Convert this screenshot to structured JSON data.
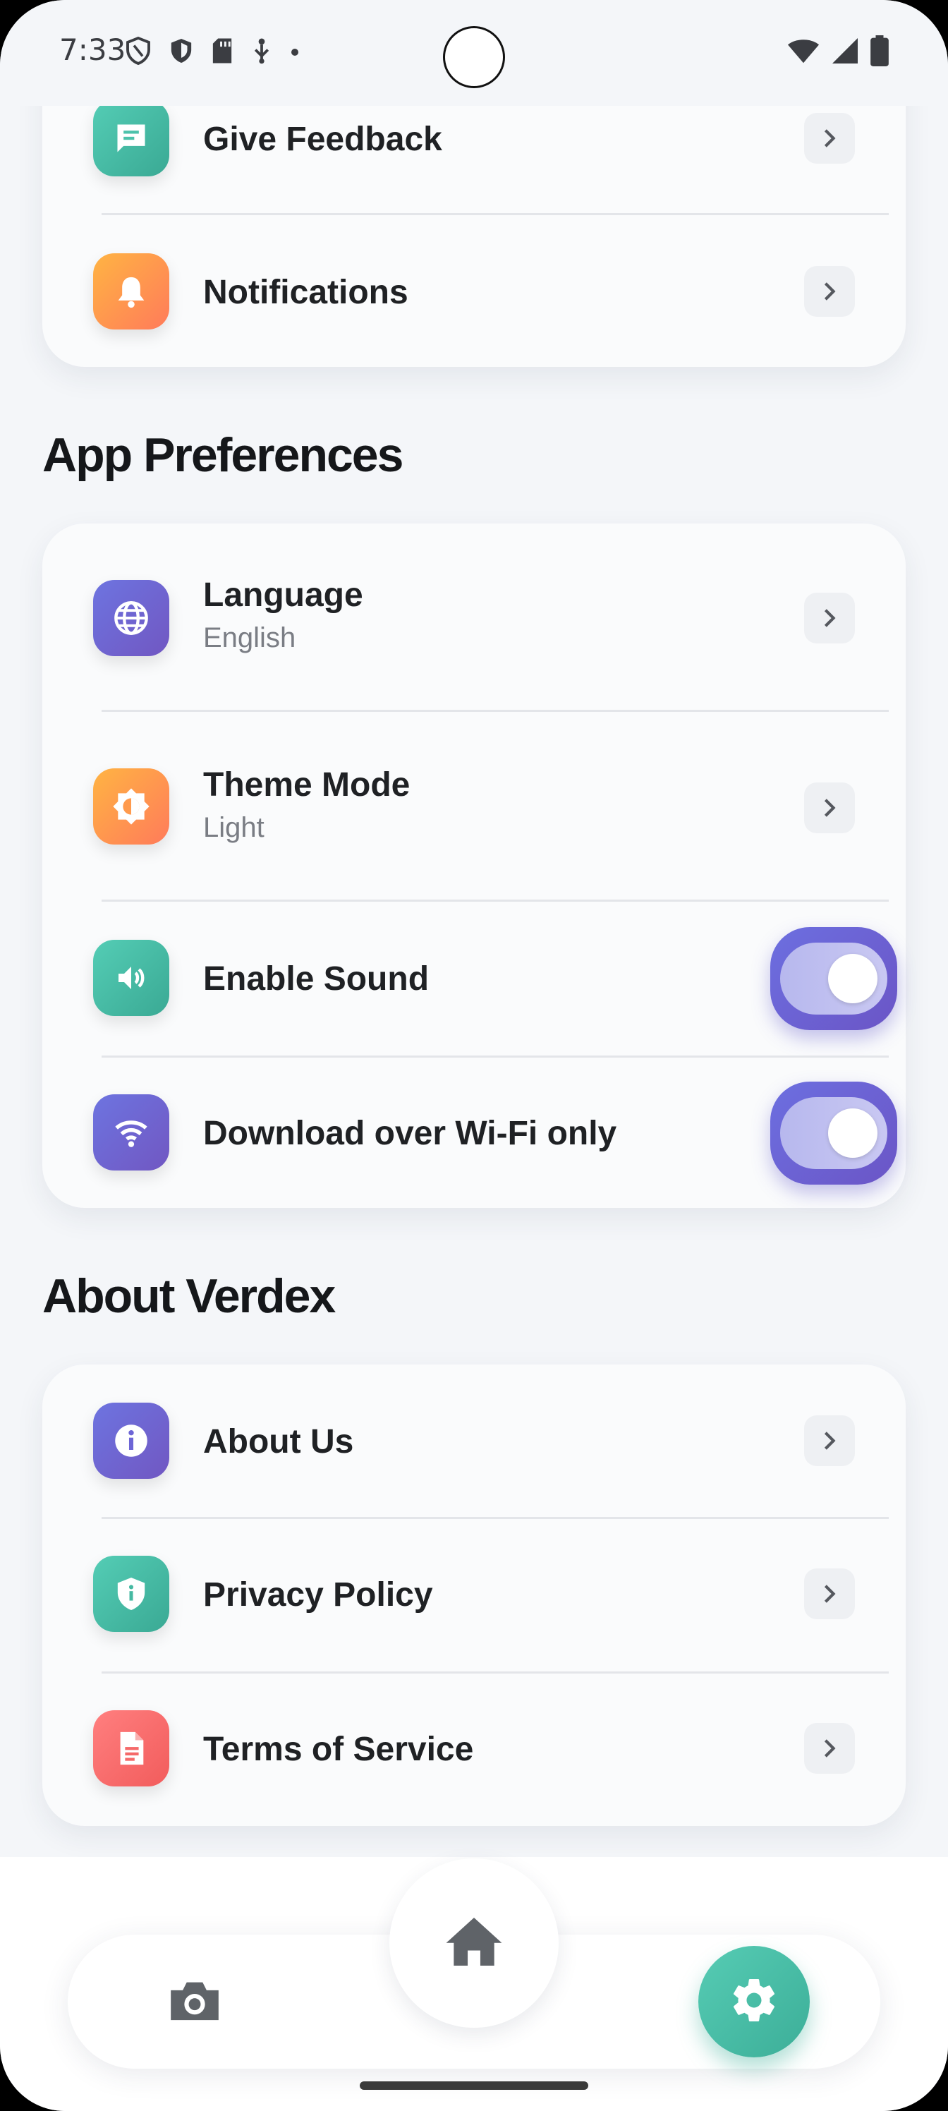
{
  "status_bar": {
    "time": "7:33",
    "left_icons": [
      "shield-outline-icon",
      "shield-filled-icon",
      "sd-card-icon",
      "usb-icon",
      "dot-icon"
    ],
    "right_icons": [
      "wifi-icon",
      "cellular-signal-icon",
      "battery-icon"
    ]
  },
  "support_section": {
    "items": [
      {
        "label": "Give Feedback",
        "icon": "feedback-icon",
        "color": "#4cc2ab"
      },
      {
        "label": "Notifications",
        "icon": "bell-icon",
        "color": "#ff9a4d"
      }
    ]
  },
  "app_preferences": {
    "title": "App Preferences",
    "items": [
      {
        "label": "Language",
        "value": "English",
        "icon": "globe-icon"
      },
      {
        "label": "Theme Mode",
        "value": "Light",
        "icon": "theme-icon"
      },
      {
        "label": "Enable Sound",
        "icon": "speaker-icon",
        "enabled": true
      },
      {
        "label": "Download over Wi-Fi only",
        "icon": "wifi-icon",
        "enabled": true
      }
    ]
  },
  "about_section": {
    "title": "About Verdex",
    "items": [
      {
        "label": "About Us",
        "icon": "info-icon"
      },
      {
        "label": "Privacy Policy",
        "icon": "shield-info-icon"
      },
      {
        "label": "Terms of Service",
        "icon": "document-icon"
      }
    ]
  },
  "bottom_nav": {
    "items": [
      "camera-icon",
      "home-icon",
      "settings-icon"
    ],
    "active": "settings-icon",
    "accent": "#4cc2ab"
  }
}
